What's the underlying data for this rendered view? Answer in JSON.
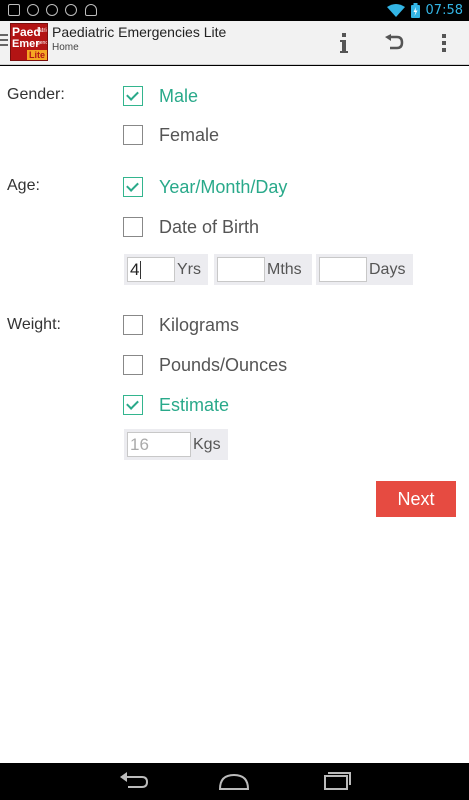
{
  "status_bar": {
    "time": "07:58",
    "icons": [
      "image-icon",
      "heart-icon",
      "chat-icon",
      "chat-icon",
      "android-icon",
      "wifi-icon",
      "battery-icon"
    ]
  },
  "action_bar": {
    "title": "Paediatric Emergencies Lite",
    "subtitle": "Home",
    "logo": {
      "line1": "Paed",
      "line1_small": "iatric",
      "line2": "Emer",
      "line2_small": "gencies",
      "badge": "Lite"
    },
    "actions": [
      "info-icon",
      "undo-icon",
      "overflow-menu-icon"
    ]
  },
  "form": {
    "gender": {
      "label": "Gender:",
      "options": [
        {
          "label": "Male",
          "checked": true
        },
        {
          "label": "Female",
          "checked": false
        }
      ]
    },
    "age": {
      "label": "Age:",
      "options": [
        {
          "label": "Year/Month/Day",
          "checked": true
        },
        {
          "label": "Date of Birth",
          "checked": false
        }
      ],
      "years": {
        "value": "4",
        "unit": "Yrs"
      },
      "months": {
        "value": "",
        "unit": "Mths"
      },
      "days": {
        "value": "",
        "unit": "Days"
      }
    },
    "weight": {
      "label": "Weight:",
      "options": [
        {
          "label": "Kilograms",
          "checked": false
        },
        {
          "label": "Pounds/Ounces",
          "checked": false
        },
        {
          "label": "Estimate",
          "checked": true
        }
      ],
      "estimate": {
        "value": "16",
        "unit": "Kgs"
      }
    },
    "next_label": "Next"
  },
  "colors": {
    "accent": "#29a98a",
    "next_button": "#e64b41",
    "status_time": "#33b5e5"
  }
}
